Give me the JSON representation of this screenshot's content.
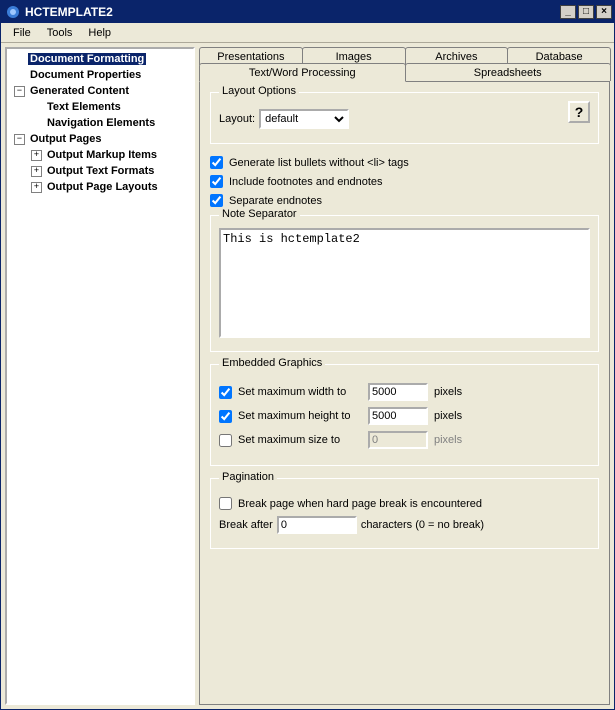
{
  "title": "HCTEMPLATE2",
  "menus": {
    "file": "File",
    "tools": "Tools",
    "help": "Help"
  },
  "tree": {
    "doc_formatting": "Document Formatting",
    "doc_properties": "Document Properties",
    "gen_content": "Generated Content",
    "text_elements": "Text Elements",
    "nav_elements": "Navigation Elements",
    "output_pages": "Output Pages",
    "markup_items": "Output Markup Items",
    "text_formats": "Output Text Formats",
    "page_layouts": "Output Page Layouts"
  },
  "tabs": {
    "presentations": "Presentations",
    "images": "Images",
    "archives": "Archives",
    "database": "Database",
    "textwp": "Text/Word Processing",
    "spreadsheets": "Spreadsheets"
  },
  "layout_options": {
    "legend": "Layout Options",
    "layout_label": "Layout:",
    "layout_value": "default",
    "help": "?"
  },
  "checks": {
    "bullets": "Generate list bullets without <li> tags",
    "footnotes": "Include footnotes and endnotes",
    "sep_endnotes": "Separate endnotes"
  },
  "note_sep": {
    "legend": "Note Separator",
    "value": "This is hctemplate2"
  },
  "embedded": {
    "legend": "Embedded Graphics",
    "max_w_label": "Set maximum width to",
    "max_w_val": "5000",
    "max_h_label": "Set maximum height to",
    "max_h_val": "5000",
    "max_s_label": "Set maximum size to",
    "max_s_val": "0",
    "pixels": "pixels"
  },
  "pagination": {
    "legend": "Pagination",
    "break_hard": "Break page when hard page break is encountered",
    "break_after_label": "Break after",
    "break_after_val": "0",
    "break_after_suffix": "characters (0 = no break)"
  }
}
